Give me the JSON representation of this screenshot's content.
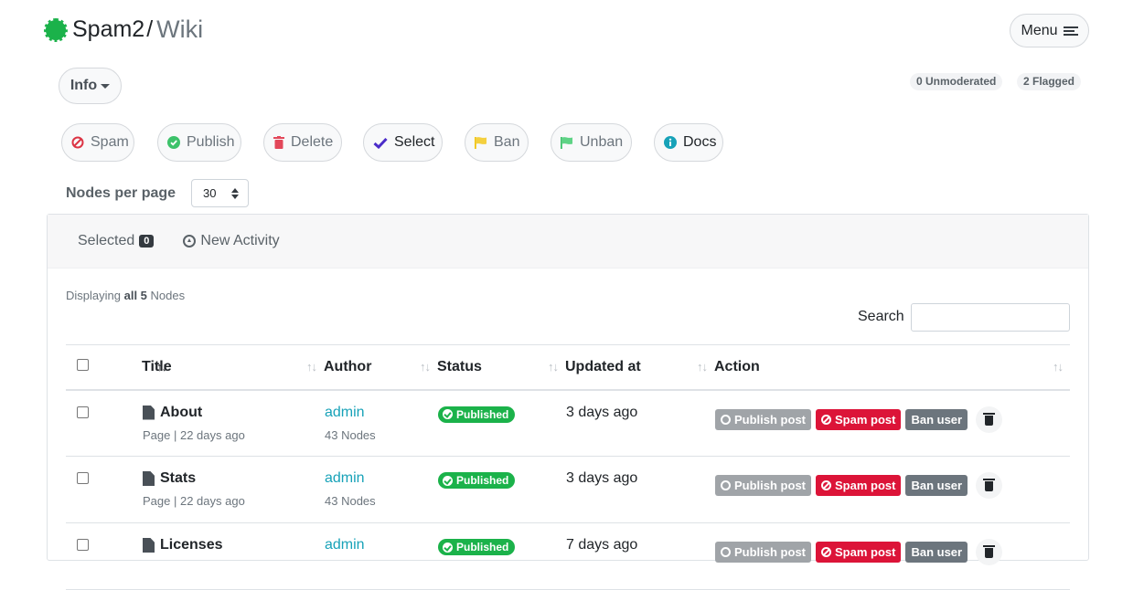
{
  "brand": {
    "site": "Spam2",
    "separator": "/",
    "page": "Wiki"
  },
  "menu": {
    "label": "Menu"
  },
  "info": {
    "label": "Info"
  },
  "counts": {
    "unmoderated": "0 Unmoderated",
    "flagged": "2 Flagged"
  },
  "actions": [
    {
      "label": "Spam",
      "icon": "ban-icon"
    },
    {
      "label": "Publish",
      "icon": "check-circle-icon"
    },
    {
      "label": "Delete",
      "icon": "trash-icon"
    },
    {
      "label": "Select",
      "icon": "checkmark-icon"
    },
    {
      "label": "Ban",
      "icon": "flag-icon"
    },
    {
      "label": "Unban",
      "icon": "flag-icon"
    },
    {
      "label": "Docs",
      "icon": "info-icon"
    }
  ],
  "nodes_per_page": {
    "label": "Nodes per page",
    "value": "30"
  },
  "tabs": {
    "selected": "Selected",
    "selected_count": "0",
    "new_activity": "New Activity"
  },
  "displaying": {
    "prefix": "Displaying",
    "all": "all 5",
    "suffix": "Nodes"
  },
  "search": {
    "label": "Search",
    "value": ""
  },
  "table": {
    "headers": {
      "title": "Title",
      "author": "Author",
      "status": "Status",
      "updated": "Updated at",
      "action": "Action"
    },
    "rows": [
      {
        "title": "About",
        "meta": "Page | 22 days ago",
        "author": "admin",
        "author_nodes": "43 Nodes",
        "status": "Published",
        "updated": "3 days ago"
      },
      {
        "title": "Stats",
        "meta": "Page | 22 days ago",
        "author": "admin",
        "author_nodes": "43 Nodes",
        "status": "Published",
        "updated": "3 days ago"
      },
      {
        "title": "Licenses",
        "meta": "",
        "author": "admin",
        "author_nodes": "",
        "status": "Published",
        "updated": "7 days ago"
      }
    ],
    "row_actions": {
      "publish": "Publish post",
      "spam": "Spam post",
      "ban": "Ban user"
    }
  },
  "colors": {
    "brand_green": "#1bb24a",
    "spam_red": "#dc1438",
    "link_teal": "#17a2b8"
  }
}
